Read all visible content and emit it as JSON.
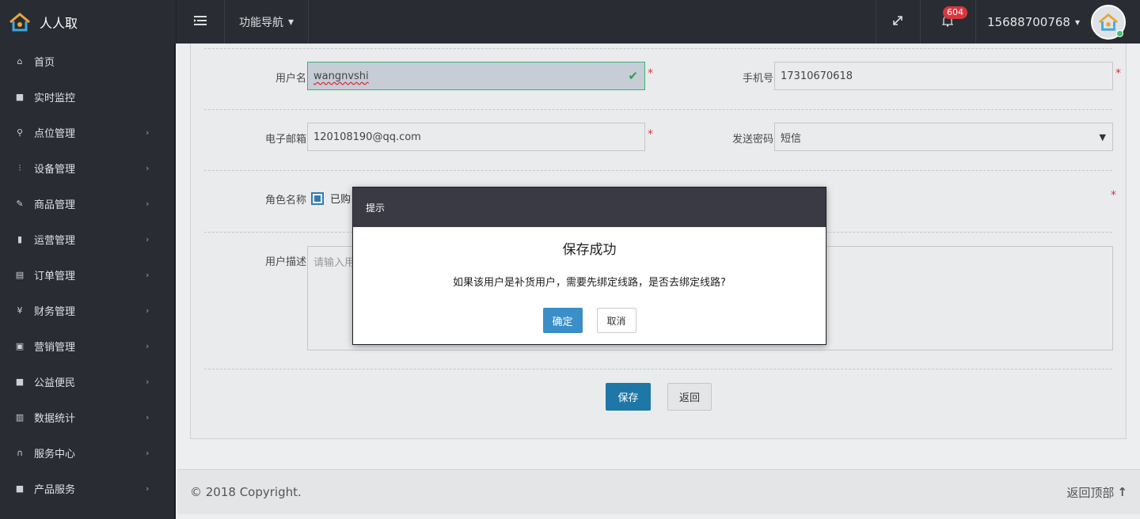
{
  "app": {
    "brand": "人人取"
  },
  "topbar": {
    "func_nav": "功能导航",
    "notifications": "604",
    "phone": "15688700768"
  },
  "sidebar": {
    "items": [
      {
        "label": "首页",
        "icon": "home-icon",
        "glyph": "⌂",
        "arrow": false
      },
      {
        "label": "实时监控",
        "icon": "video-icon",
        "glyph": "■",
        "arrow": false
      },
      {
        "label": "点位管理",
        "icon": "map-marker-icon",
        "glyph": "⚲",
        "arrow": true
      },
      {
        "label": "设备管理",
        "icon": "sliders-icon",
        "glyph": "⫶",
        "arrow": true
      },
      {
        "label": "商品管理",
        "icon": "edit-icon",
        "glyph": "✎",
        "arrow": true
      },
      {
        "label": "运营管理",
        "icon": "bookmark-icon",
        "glyph": "▮",
        "arrow": true
      },
      {
        "label": "订单管理",
        "icon": "list-icon",
        "glyph": "▤",
        "arrow": true
      },
      {
        "label": "财务管理",
        "icon": "yen-icon",
        "glyph": "¥",
        "arrow": true
      },
      {
        "label": "营销管理",
        "icon": "gift-icon",
        "glyph": "▣",
        "arrow": true
      },
      {
        "label": "公益便民",
        "icon": "square-icon",
        "glyph": "■",
        "arrow": true
      },
      {
        "label": "数据统计",
        "icon": "bar-chart-icon",
        "glyph": "▥",
        "arrow": true
      },
      {
        "label": "服务中心",
        "icon": "headset-icon",
        "glyph": "∩",
        "arrow": true
      },
      {
        "label": "产品服务",
        "icon": "square-icon",
        "glyph": "■",
        "arrow": true
      }
    ]
  },
  "form": {
    "username_label": "用户名",
    "username_value": "wangnvshi",
    "phone_label": "手机号",
    "phone_value": "17310670618",
    "email_label": "电子邮箱",
    "email_value": "120108190@qq.com",
    "send_pwd_label": "发送密码",
    "send_pwd_value": "短信",
    "role_label": "角色名称",
    "role_option": "已购",
    "desc_label": "用户描述",
    "desc_placeholder": "请输入用",
    "required_mark": "*",
    "save_button": "保存",
    "back_button": "返回"
  },
  "footer": {
    "copyright": "© 2018 Copyright.",
    "back_top": "返回顶部"
  },
  "modal": {
    "header": "提示",
    "title": "保存成功",
    "message": "如果该用户是补货用户，需要先绑定线路，是否去绑定线路?",
    "ok": "确定",
    "cancel": "取消"
  },
  "colors": {
    "sidebar_bg": "#2a2c33",
    "primary": "#1f77a8",
    "success": "#3cb371",
    "required": "#d9363e"
  }
}
